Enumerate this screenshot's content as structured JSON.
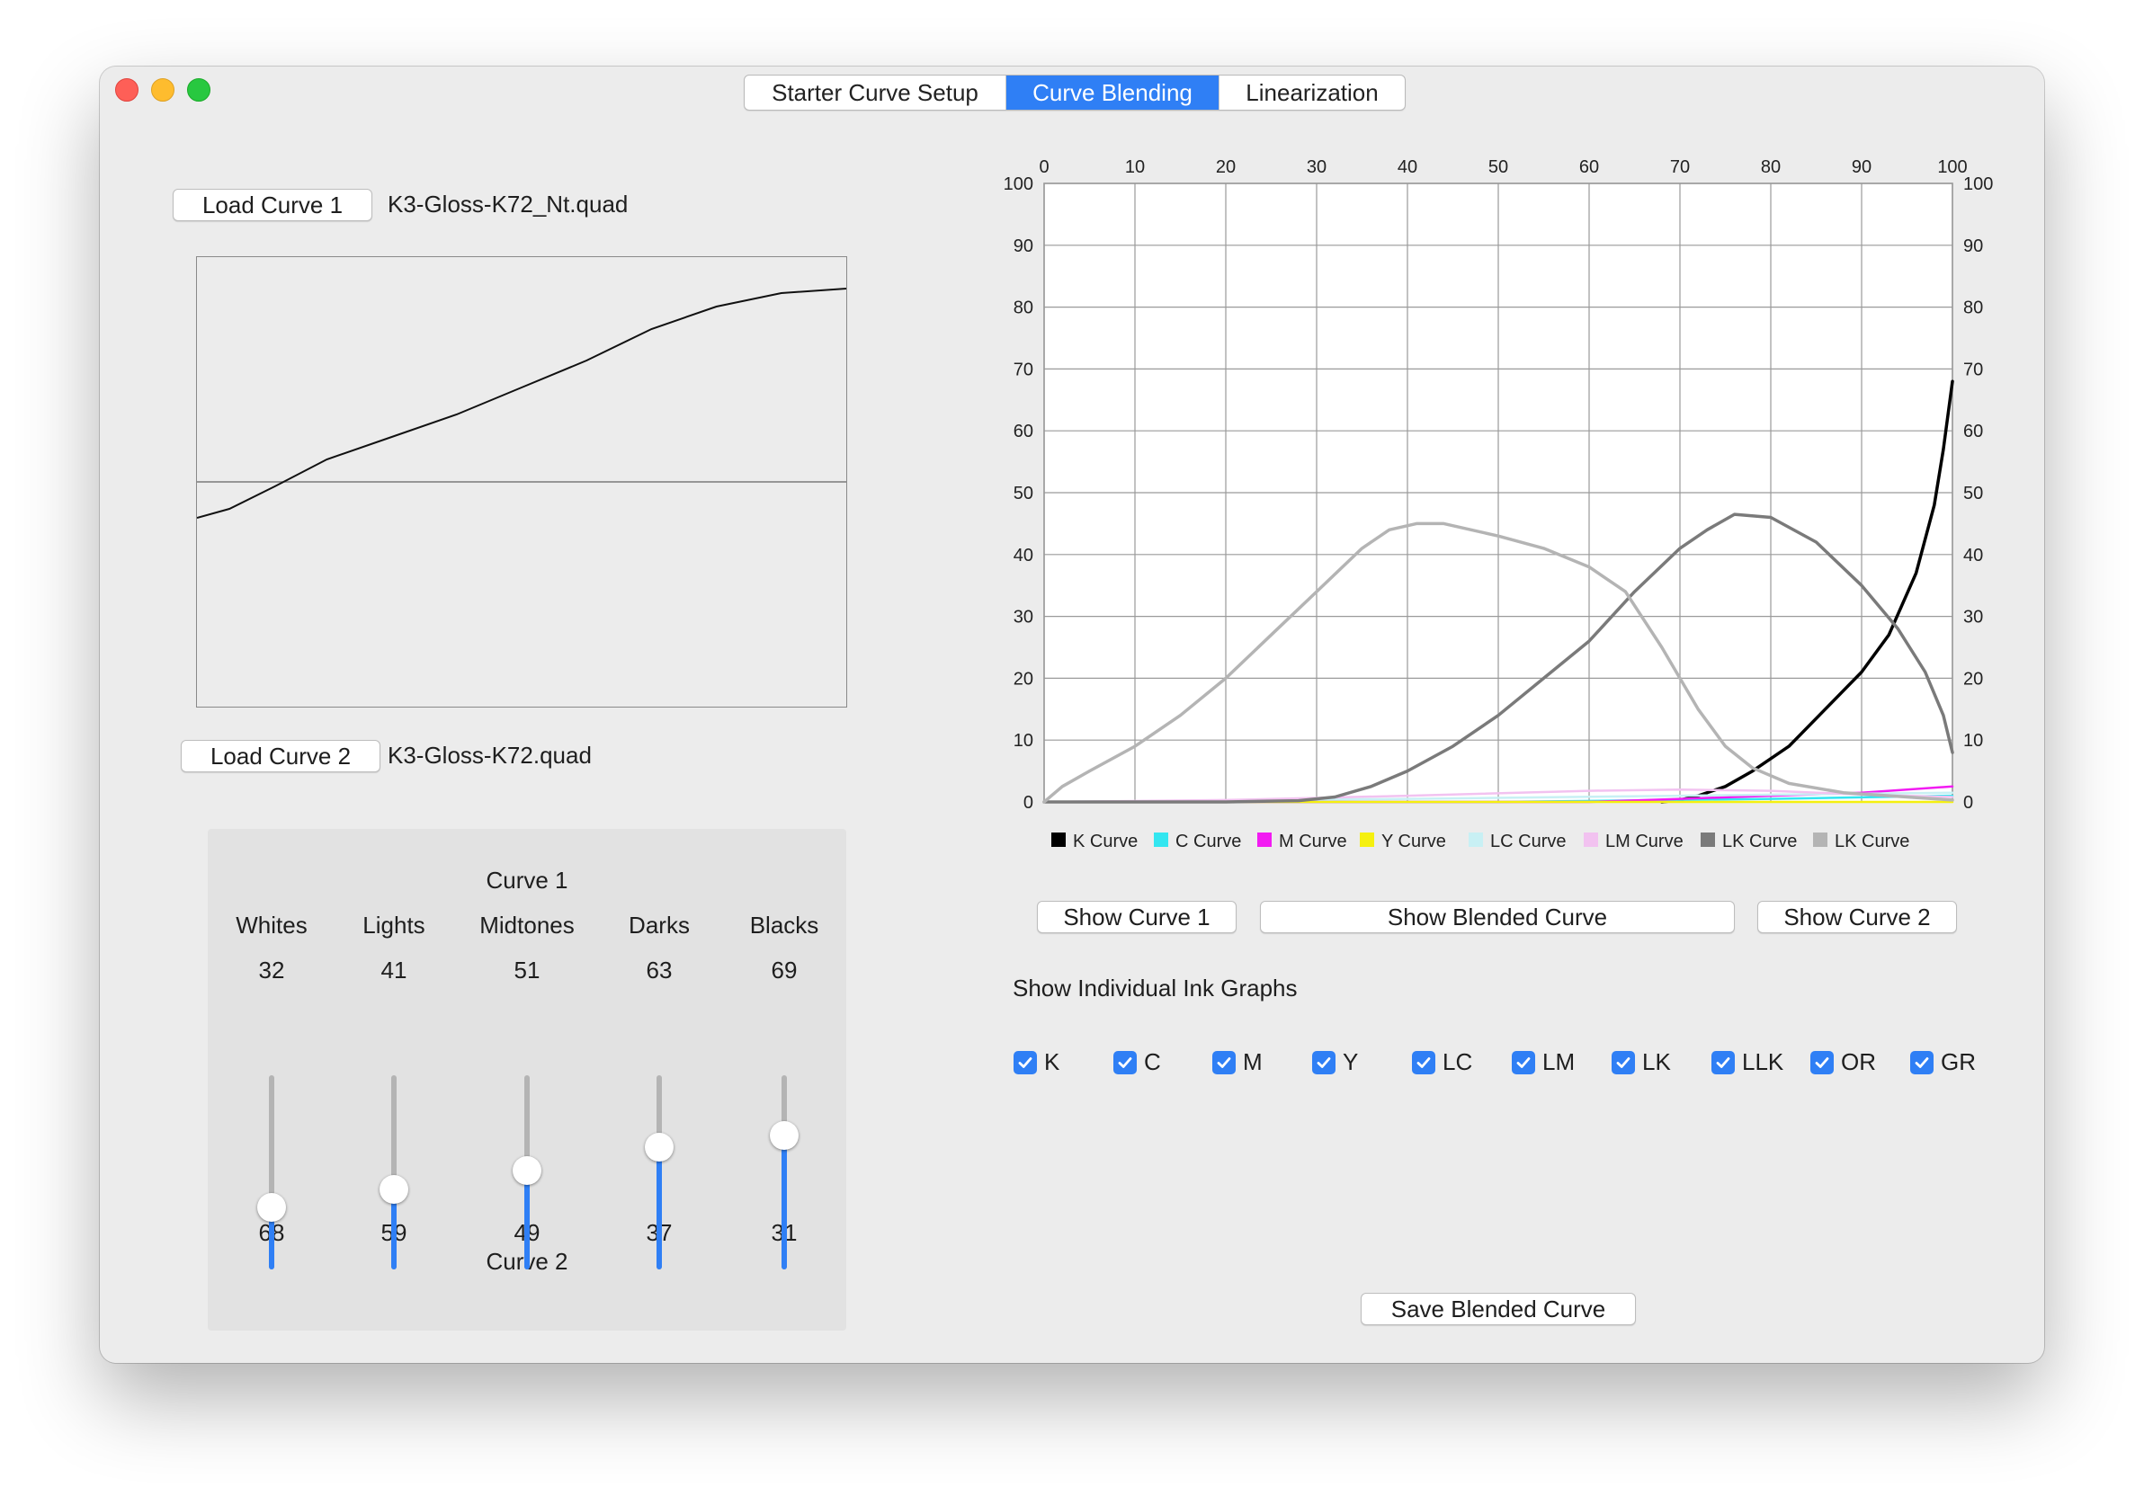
{
  "window": {
    "tabs": [
      {
        "label": "Starter Curve Setup",
        "active": false
      },
      {
        "label": "Curve Blending",
        "active": true
      },
      {
        "label": "Linearization",
        "active": false
      }
    ]
  },
  "left": {
    "load_curve_1": "Load Curve 1",
    "curve_1_file": "K3-Gloss-K72_Nt.quad",
    "load_curve_2": "Load Curve 2",
    "curve_2_file": "K3-Gloss-K72.quad",
    "preview_curve": [
      [
        0,
        42
      ],
      [
        5,
        44
      ],
      [
        12,
        49
      ],
      [
        20,
        55
      ],
      [
        30,
        60
      ],
      [
        40,
        65
      ],
      [
        50,
        71
      ],
      [
        60,
        77
      ],
      [
        70,
        84
      ],
      [
        80,
        89
      ],
      [
        90,
        92
      ],
      [
        100,
        93
      ]
    ],
    "sliders": {
      "curve1_label": "Curve 1",
      "curve2_label": "Curve 2",
      "items": [
        {
          "name": "Whites",
          "curve1": "32",
          "curve2": "68",
          "level": 0.32
        },
        {
          "name": "Lights",
          "curve1": "41",
          "curve2": "59",
          "level": 0.41
        },
        {
          "name": "Midtones",
          "curve1": "51",
          "curve2": "49",
          "level": 0.51
        },
        {
          "name": "Darks",
          "curve1": "63",
          "curve2": "37",
          "level": 0.63
        },
        {
          "name": "Blacks",
          "curve1": "69",
          "curve2": "31",
          "level": 0.69
        }
      ]
    }
  },
  "chart_data": {
    "type": "line",
    "xlim": [
      0,
      100
    ],
    "ylim": [
      0,
      100
    ],
    "x_ticks": [
      "0",
      "10",
      "20",
      "30",
      "40",
      "50",
      "60",
      "70",
      "80",
      "90",
      "100"
    ],
    "y_ticks": [
      "0",
      "10",
      "20",
      "30",
      "40",
      "50",
      "60",
      "70",
      "80",
      "90",
      "100"
    ],
    "grid": true,
    "legend_position": "bottom",
    "series": [
      {
        "name": "K Curve",
        "color": "#000000",
        "points": [
          [
            68,
            0
          ],
          [
            70,
            0.3
          ],
          [
            72,
            1
          ],
          [
            75,
            2.5
          ],
          [
            78,
            5
          ],
          [
            82,
            9
          ],
          [
            86,
            15
          ],
          [
            90,
            21
          ],
          [
            93,
            27
          ],
          [
            96,
            37
          ],
          [
            98,
            48
          ],
          [
            99,
            57
          ],
          [
            100,
            68
          ]
        ]
      },
      {
        "name": "C Curve",
        "color": "#33e6f0",
        "points": [
          [
            0,
            0
          ],
          [
            50,
            0
          ],
          [
            80,
            0.5
          ],
          [
            100,
            1
          ]
        ]
      },
      {
        "name": "M Curve",
        "color": "#f21bf2",
        "points": [
          [
            0,
            0
          ],
          [
            60,
            0
          ],
          [
            70,
            0.5
          ],
          [
            80,
            1
          ],
          [
            90,
            1.5
          ],
          [
            100,
            2.5
          ]
        ]
      },
      {
        "name": "Y Curve",
        "color": "#f5f00f",
        "points": [
          [
            0,
            0
          ],
          [
            100,
            0
          ]
        ]
      },
      {
        "name": "LC Curve",
        "color": "#c8f0f4",
        "points": [
          [
            0,
            0
          ],
          [
            40,
            0.5
          ],
          [
            70,
            1
          ],
          [
            100,
            1.5
          ]
        ]
      },
      {
        "name": "LM Curve",
        "color": "#f2c2f0",
        "points": [
          [
            0,
            0
          ],
          [
            20,
            0.3
          ],
          [
            40,
            1
          ],
          [
            60,
            1.8
          ],
          [
            70,
            2
          ],
          [
            80,
            1.8
          ],
          [
            90,
            1.2
          ],
          [
            100,
            0.8
          ]
        ]
      },
      {
        "name": "LK Curve",
        "color": "#7a7a7a",
        "points": [
          [
            0,
            0
          ],
          [
            20,
            0
          ],
          [
            28,
            0.2
          ],
          [
            32,
            0.8
          ],
          [
            36,
            2.5
          ],
          [
            40,
            5
          ],
          [
            45,
            9
          ],
          [
            50,
            14
          ],
          [
            55,
            20
          ],
          [
            60,
            26
          ],
          [
            65,
            34
          ],
          [
            70,
            41
          ],
          [
            73,
            44
          ],
          [
            76,
            46.5
          ],
          [
            80,
            46
          ],
          [
            85,
            42
          ],
          [
            90,
            35
          ],
          [
            94,
            28
          ],
          [
            97,
            21
          ],
          [
            99,
            14
          ],
          [
            100,
            8
          ]
        ]
      },
      {
        "name": "LK Curve",
        "color": "#b4b4b4",
        "points": [
          [
            0,
            0
          ],
          [
            2,
            2.5
          ],
          [
            5,
            5
          ],
          [
            10,
            9
          ],
          [
            15,
            14
          ],
          [
            20,
            20
          ],
          [
            25,
            27
          ],
          [
            30,
            34
          ],
          [
            35,
            41
          ],
          [
            38,
            44
          ],
          [
            41,
            45
          ],
          [
            44,
            45
          ],
          [
            50,
            43
          ],
          [
            55,
            41
          ],
          [
            60,
            38
          ],
          [
            64,
            34
          ],
          [
            68,
            25
          ],
          [
            72,
            15
          ],
          [
            75,
            9
          ],
          [
            78,
            5.5
          ],
          [
            82,
            3
          ],
          [
            88,
            1.5
          ],
          [
            95,
            0.8
          ],
          [
            100,
            0.3
          ]
        ]
      }
    ]
  },
  "right": {
    "show_curve_1": "Show Curve 1",
    "show_blended": "Show Blended Curve",
    "show_curve_2": "Show Curve 2",
    "ink_graphs_label": "Show Individual Ink Graphs",
    "inks": [
      "K",
      "C",
      "M",
      "Y",
      "LC",
      "LM",
      "LK",
      "LLK",
      "OR",
      "GR"
    ],
    "save_blended": "Save Blended Curve"
  }
}
